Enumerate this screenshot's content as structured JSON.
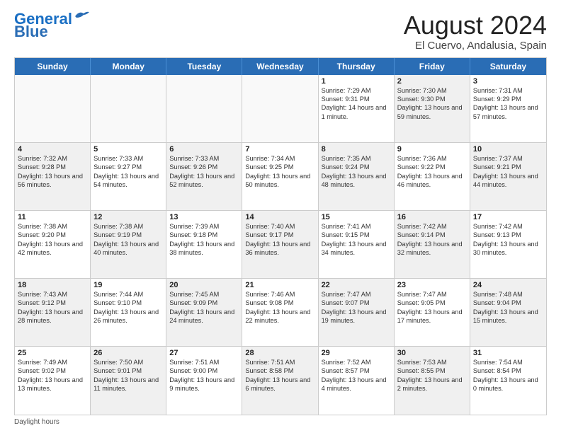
{
  "logo": {
    "line1": "General",
    "line2": "Blue"
  },
  "title": {
    "month_year": "August 2024",
    "location": "El Cuervo, Andalusia, Spain"
  },
  "header_days": [
    "Sunday",
    "Monday",
    "Tuesday",
    "Wednesday",
    "Thursday",
    "Friday",
    "Saturday"
  ],
  "weeks": [
    [
      {
        "day": "",
        "sunrise": "",
        "sunset": "",
        "daylight": "",
        "shaded": true
      },
      {
        "day": "",
        "sunrise": "",
        "sunset": "",
        "daylight": "",
        "shaded": true
      },
      {
        "day": "",
        "sunrise": "",
        "sunset": "",
        "daylight": "",
        "shaded": true
      },
      {
        "day": "",
        "sunrise": "",
        "sunset": "",
        "daylight": "",
        "shaded": true
      },
      {
        "day": "1",
        "sunrise": "Sunrise: 7:29 AM",
        "sunset": "Sunset: 9:31 PM",
        "daylight": "Daylight: 14 hours and 1 minute.",
        "shaded": false
      },
      {
        "day": "2",
        "sunrise": "Sunrise: 7:30 AM",
        "sunset": "Sunset: 9:30 PM",
        "daylight": "Daylight: 13 hours and 59 minutes.",
        "shaded": true
      },
      {
        "day": "3",
        "sunrise": "Sunrise: 7:31 AM",
        "sunset": "Sunset: 9:29 PM",
        "daylight": "Daylight: 13 hours and 57 minutes.",
        "shaded": false
      }
    ],
    [
      {
        "day": "4",
        "sunrise": "Sunrise: 7:32 AM",
        "sunset": "Sunset: 9:28 PM",
        "daylight": "Daylight: 13 hours and 56 minutes.",
        "shaded": true
      },
      {
        "day": "5",
        "sunrise": "Sunrise: 7:33 AM",
        "sunset": "Sunset: 9:27 PM",
        "daylight": "Daylight: 13 hours and 54 minutes.",
        "shaded": false
      },
      {
        "day": "6",
        "sunrise": "Sunrise: 7:33 AM",
        "sunset": "Sunset: 9:26 PM",
        "daylight": "Daylight: 13 hours and 52 minutes.",
        "shaded": true
      },
      {
        "day": "7",
        "sunrise": "Sunrise: 7:34 AM",
        "sunset": "Sunset: 9:25 PM",
        "daylight": "Daylight: 13 hours and 50 minutes.",
        "shaded": false
      },
      {
        "day": "8",
        "sunrise": "Sunrise: 7:35 AM",
        "sunset": "Sunset: 9:24 PM",
        "daylight": "Daylight: 13 hours and 48 minutes.",
        "shaded": true
      },
      {
        "day": "9",
        "sunrise": "Sunrise: 7:36 AM",
        "sunset": "Sunset: 9:22 PM",
        "daylight": "Daylight: 13 hours and 46 minutes.",
        "shaded": false
      },
      {
        "day": "10",
        "sunrise": "Sunrise: 7:37 AM",
        "sunset": "Sunset: 9:21 PM",
        "daylight": "Daylight: 13 hours and 44 minutes.",
        "shaded": true
      }
    ],
    [
      {
        "day": "11",
        "sunrise": "Sunrise: 7:38 AM",
        "sunset": "Sunset: 9:20 PM",
        "daylight": "Daylight: 13 hours and 42 minutes.",
        "shaded": false
      },
      {
        "day": "12",
        "sunrise": "Sunrise: 7:38 AM",
        "sunset": "Sunset: 9:19 PM",
        "daylight": "Daylight: 13 hours and 40 minutes.",
        "shaded": true
      },
      {
        "day": "13",
        "sunrise": "Sunrise: 7:39 AM",
        "sunset": "Sunset: 9:18 PM",
        "daylight": "Daylight: 13 hours and 38 minutes.",
        "shaded": false
      },
      {
        "day": "14",
        "sunrise": "Sunrise: 7:40 AM",
        "sunset": "Sunset: 9:17 PM",
        "daylight": "Daylight: 13 hours and 36 minutes.",
        "shaded": true
      },
      {
        "day": "15",
        "sunrise": "Sunrise: 7:41 AM",
        "sunset": "Sunset: 9:15 PM",
        "daylight": "Daylight: 13 hours and 34 minutes.",
        "shaded": false
      },
      {
        "day": "16",
        "sunrise": "Sunrise: 7:42 AM",
        "sunset": "Sunset: 9:14 PM",
        "daylight": "Daylight: 13 hours and 32 minutes.",
        "shaded": true
      },
      {
        "day": "17",
        "sunrise": "Sunrise: 7:42 AM",
        "sunset": "Sunset: 9:13 PM",
        "daylight": "Daylight: 13 hours and 30 minutes.",
        "shaded": false
      }
    ],
    [
      {
        "day": "18",
        "sunrise": "Sunrise: 7:43 AM",
        "sunset": "Sunset: 9:12 PM",
        "daylight": "Daylight: 13 hours and 28 minutes.",
        "shaded": true
      },
      {
        "day": "19",
        "sunrise": "Sunrise: 7:44 AM",
        "sunset": "Sunset: 9:10 PM",
        "daylight": "Daylight: 13 hours and 26 minutes.",
        "shaded": false
      },
      {
        "day": "20",
        "sunrise": "Sunrise: 7:45 AM",
        "sunset": "Sunset: 9:09 PM",
        "daylight": "Daylight: 13 hours and 24 minutes.",
        "shaded": true
      },
      {
        "day": "21",
        "sunrise": "Sunrise: 7:46 AM",
        "sunset": "Sunset: 9:08 PM",
        "daylight": "Daylight: 13 hours and 22 minutes.",
        "shaded": false
      },
      {
        "day": "22",
        "sunrise": "Sunrise: 7:47 AM",
        "sunset": "Sunset: 9:07 PM",
        "daylight": "Daylight: 13 hours and 19 minutes.",
        "shaded": true
      },
      {
        "day": "23",
        "sunrise": "Sunrise: 7:47 AM",
        "sunset": "Sunset: 9:05 PM",
        "daylight": "Daylight: 13 hours and 17 minutes.",
        "shaded": false
      },
      {
        "day": "24",
        "sunrise": "Sunrise: 7:48 AM",
        "sunset": "Sunset: 9:04 PM",
        "daylight": "Daylight: 13 hours and 15 minutes.",
        "shaded": true
      }
    ],
    [
      {
        "day": "25",
        "sunrise": "Sunrise: 7:49 AM",
        "sunset": "Sunset: 9:02 PM",
        "daylight": "Daylight: 13 hours and 13 minutes.",
        "shaded": false
      },
      {
        "day": "26",
        "sunrise": "Sunrise: 7:50 AM",
        "sunset": "Sunset: 9:01 PM",
        "daylight": "Daylight: 13 hours and 11 minutes.",
        "shaded": true
      },
      {
        "day": "27",
        "sunrise": "Sunrise: 7:51 AM",
        "sunset": "Sunset: 9:00 PM",
        "daylight": "Daylight: 13 hours and 9 minutes.",
        "shaded": false
      },
      {
        "day": "28",
        "sunrise": "Sunrise: 7:51 AM",
        "sunset": "Sunset: 8:58 PM",
        "daylight": "Daylight: 13 hours and 6 minutes.",
        "shaded": true
      },
      {
        "day": "29",
        "sunrise": "Sunrise: 7:52 AM",
        "sunset": "Sunset: 8:57 PM",
        "daylight": "Daylight: 13 hours and 4 minutes.",
        "shaded": false
      },
      {
        "day": "30",
        "sunrise": "Sunrise: 7:53 AM",
        "sunset": "Sunset: 8:55 PM",
        "daylight": "Daylight: 13 hours and 2 minutes.",
        "shaded": true
      },
      {
        "day": "31",
        "sunrise": "Sunrise: 7:54 AM",
        "sunset": "Sunset: 8:54 PM",
        "daylight": "Daylight: 13 hours and 0 minutes.",
        "shaded": false
      }
    ]
  ],
  "footer": {
    "note": "Daylight hours"
  }
}
